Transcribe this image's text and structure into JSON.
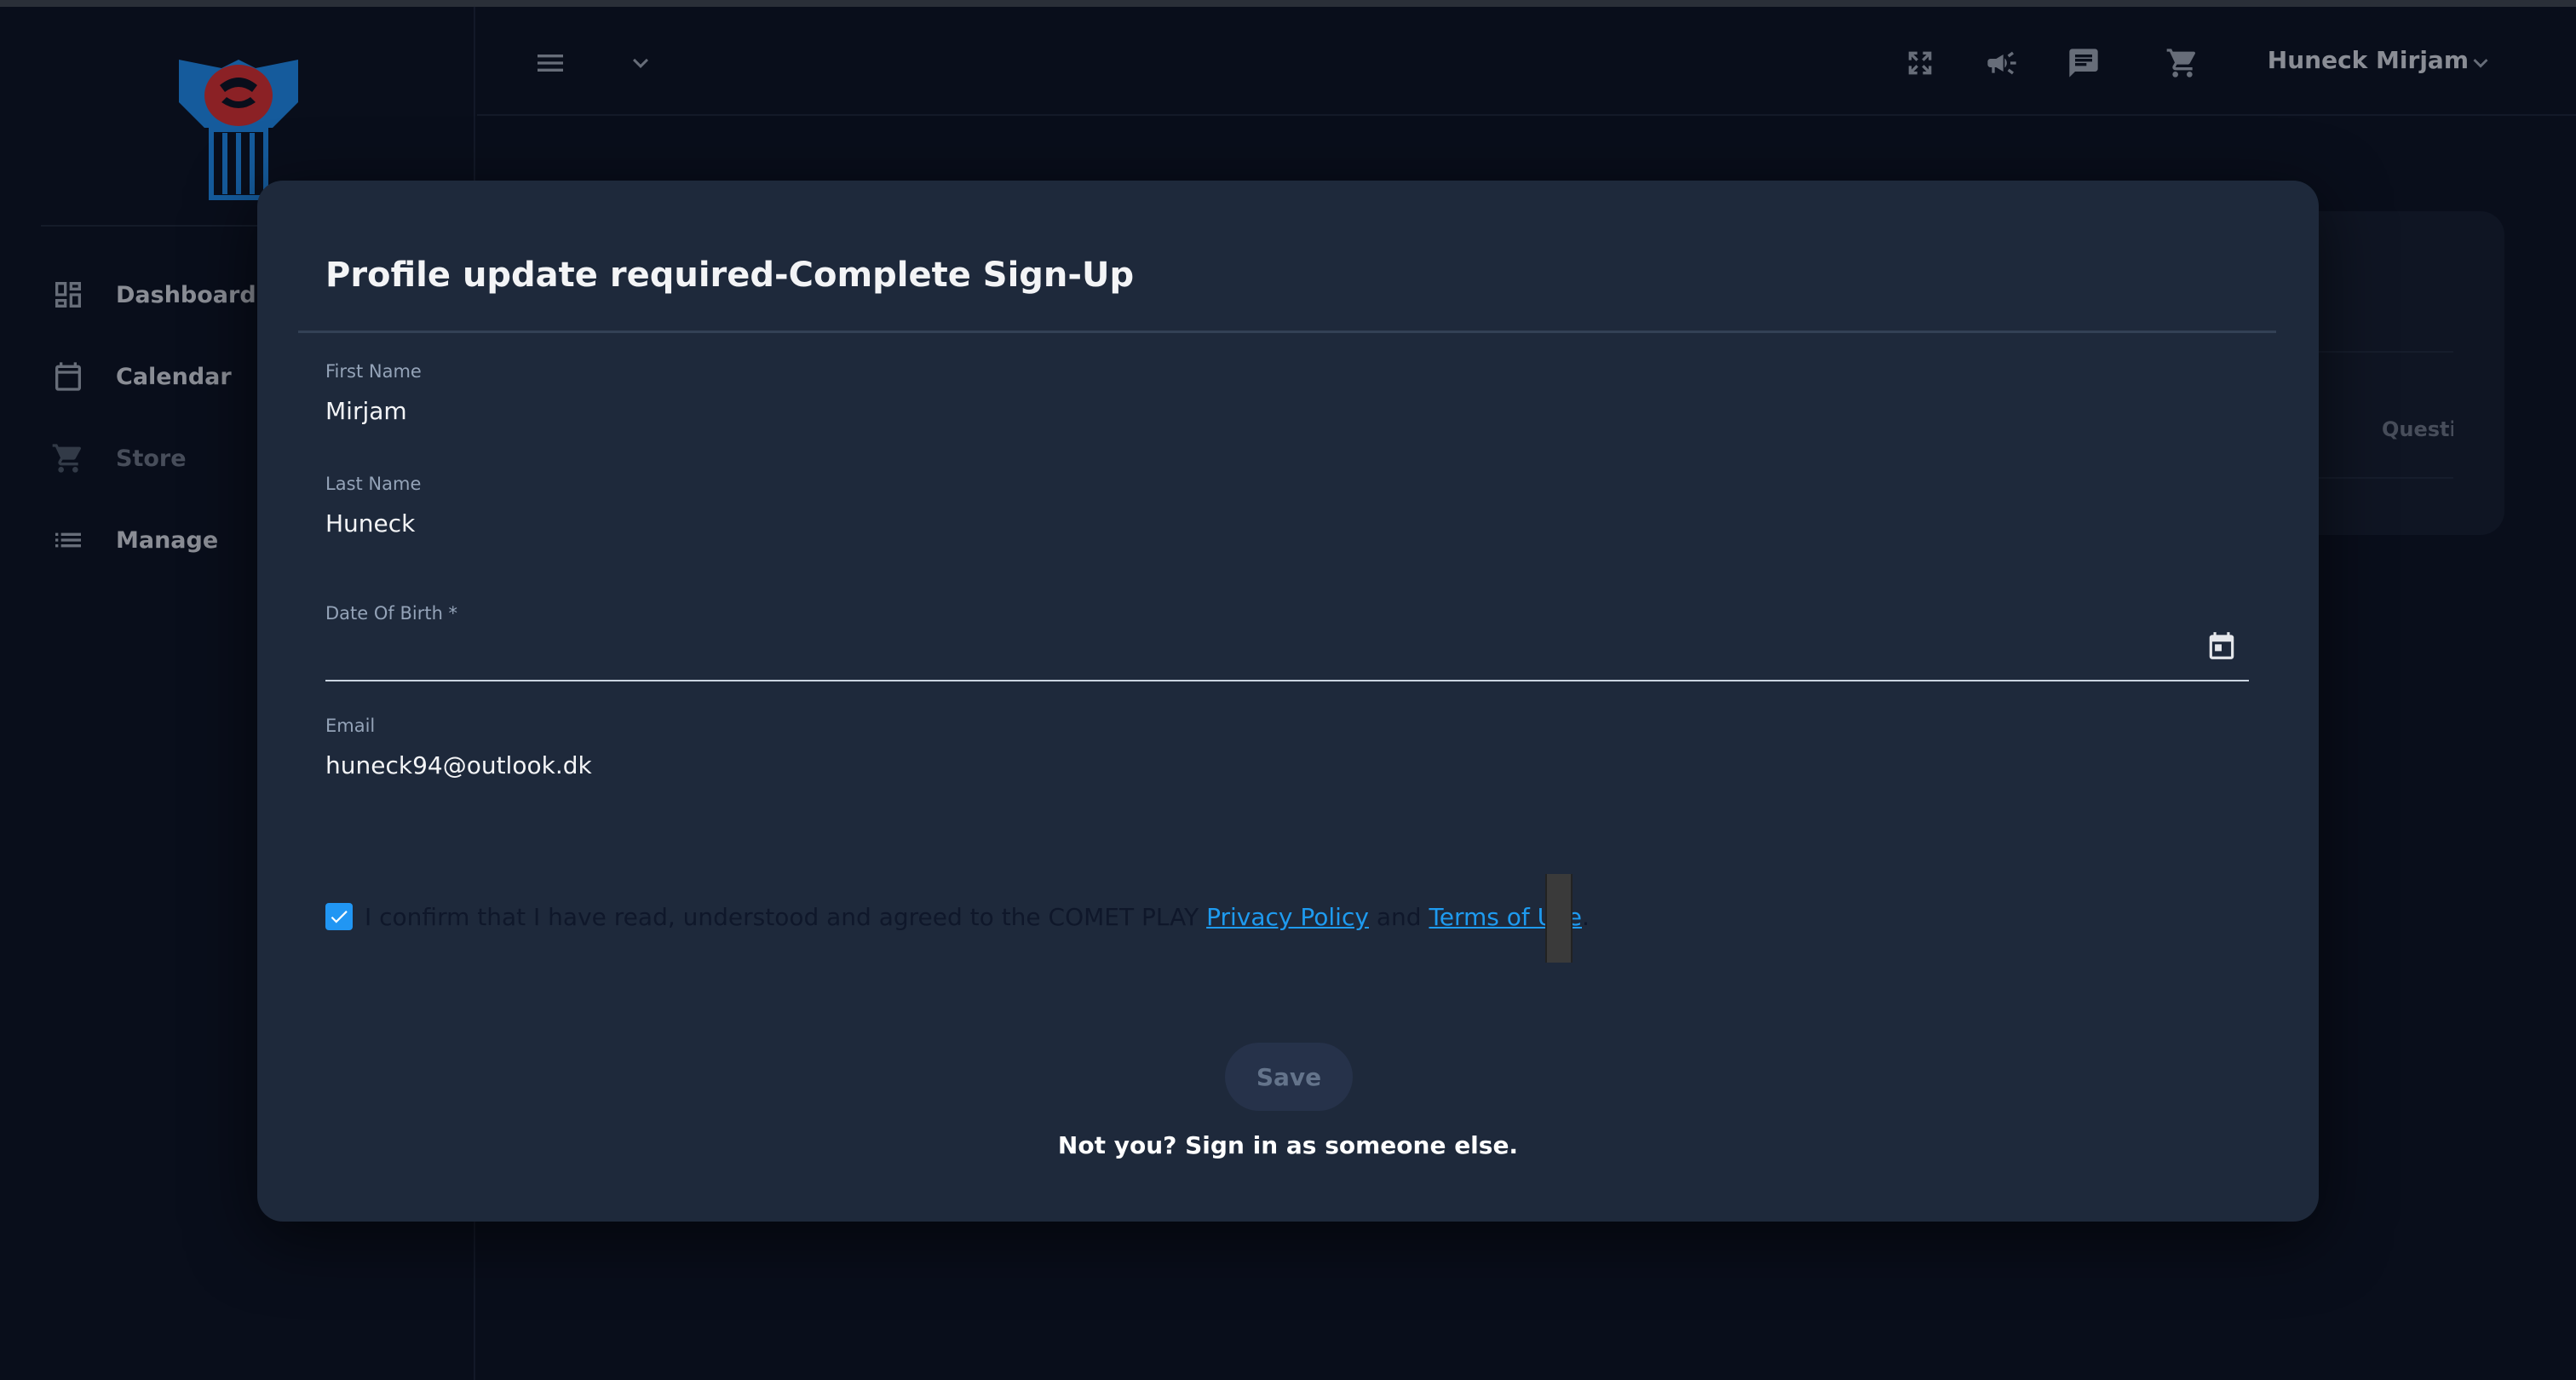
{
  "sidebar": {
    "items": [
      {
        "label": "Dashboard",
        "icon": "dashboard-icon"
      },
      {
        "label": "Calendar",
        "icon": "calendar-icon"
      },
      {
        "label": "Store",
        "icon": "cart-icon"
      },
      {
        "label": "Manage",
        "icon": "list-icon"
      }
    ]
  },
  "topbar": {
    "icons": [
      "menu-icon",
      "chevron-down-icon",
      "fullscreen-icon",
      "megaphone-icon",
      "chat-icon",
      "cart-icon"
    ],
    "user_name": "Huneck Mirjam"
  },
  "background_card": {
    "label": "Questic"
  },
  "modal": {
    "title": "Profile update required-Complete Sign-Up",
    "fields": {
      "first_name": {
        "label": "First Name",
        "value": "Mirjam"
      },
      "last_name": {
        "label": "Last Name",
        "value": "Huneck"
      },
      "dob": {
        "label": "Date Of Birth *",
        "value": ""
      },
      "email": {
        "label": "Email",
        "value": "huneck94@outlook.dk"
      }
    },
    "consent": {
      "checked": true,
      "text": "I confirm that I have read, understood and agreed to the COMET PLAY",
      "privacy_link": "Privacy Policy",
      "and": "and",
      "terms_link": "Terms of Use",
      "end": "."
    },
    "save_label": "Save",
    "signin_text": "Not you? Sign in as someone else."
  },
  "colors": {
    "accent": "#2196f3",
    "link": "#1e9bf0",
    "modal_bg": "#1e293b",
    "page_bg": "#0b1120",
    "logo_red": "#d32f2f",
    "logo_blue": "#1e88e5"
  }
}
